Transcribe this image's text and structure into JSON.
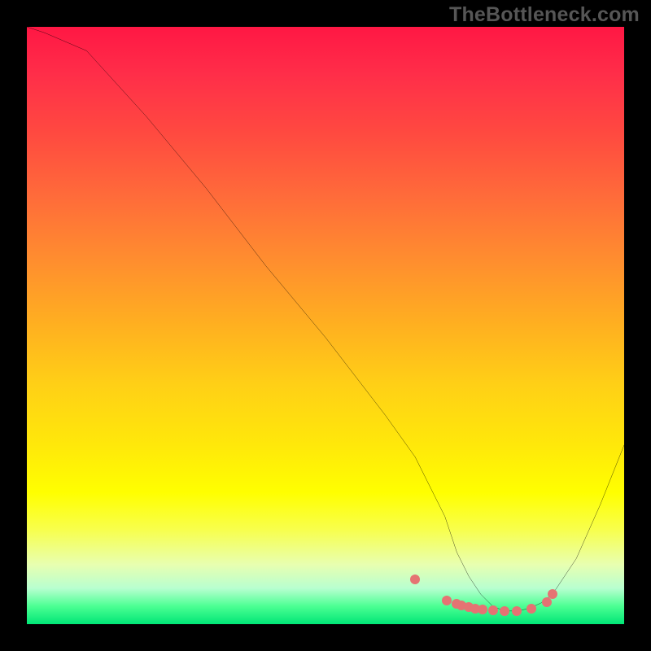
{
  "watermark": "TheBottleneck.com",
  "chart_data": {
    "type": "line",
    "title": "",
    "xlabel": "",
    "ylabel": "",
    "xlim": [
      0,
      100
    ],
    "ylim": [
      0,
      100
    ],
    "x": [
      0,
      3,
      10,
      20,
      30,
      40,
      50,
      60,
      65,
      70,
      72,
      74,
      76,
      78,
      80,
      82,
      84,
      86,
      88,
      92,
      96,
      100
    ],
    "y": [
      100,
      99,
      96,
      85,
      73,
      60,
      48,
      35,
      28,
      18,
      12,
      8,
      5,
      3,
      2.2,
      2.2,
      2.6,
      3.5,
      5,
      11,
      20,
      30
    ],
    "dots_x": [
      65.0,
      70.3,
      72.0,
      72.8,
      74.0,
      75.0,
      76.3,
      78.0,
      80.0,
      82.0,
      84.5,
      87.0,
      88.0
    ],
    "dots_y": [
      7.5,
      4.0,
      3.4,
      3.2,
      2.9,
      2.6,
      2.4,
      2.3,
      2.2,
      2.2,
      2.6,
      3.7,
      5.0
    ],
    "gradient_colors": [
      "#ff1744",
      "#ff6a3a",
      "#ffb020",
      "#ffe80a",
      "#ffff00",
      "#e8ffb0",
      "#00e676"
    ],
    "dot_color": "#e57373",
    "line_color": "#000000"
  }
}
